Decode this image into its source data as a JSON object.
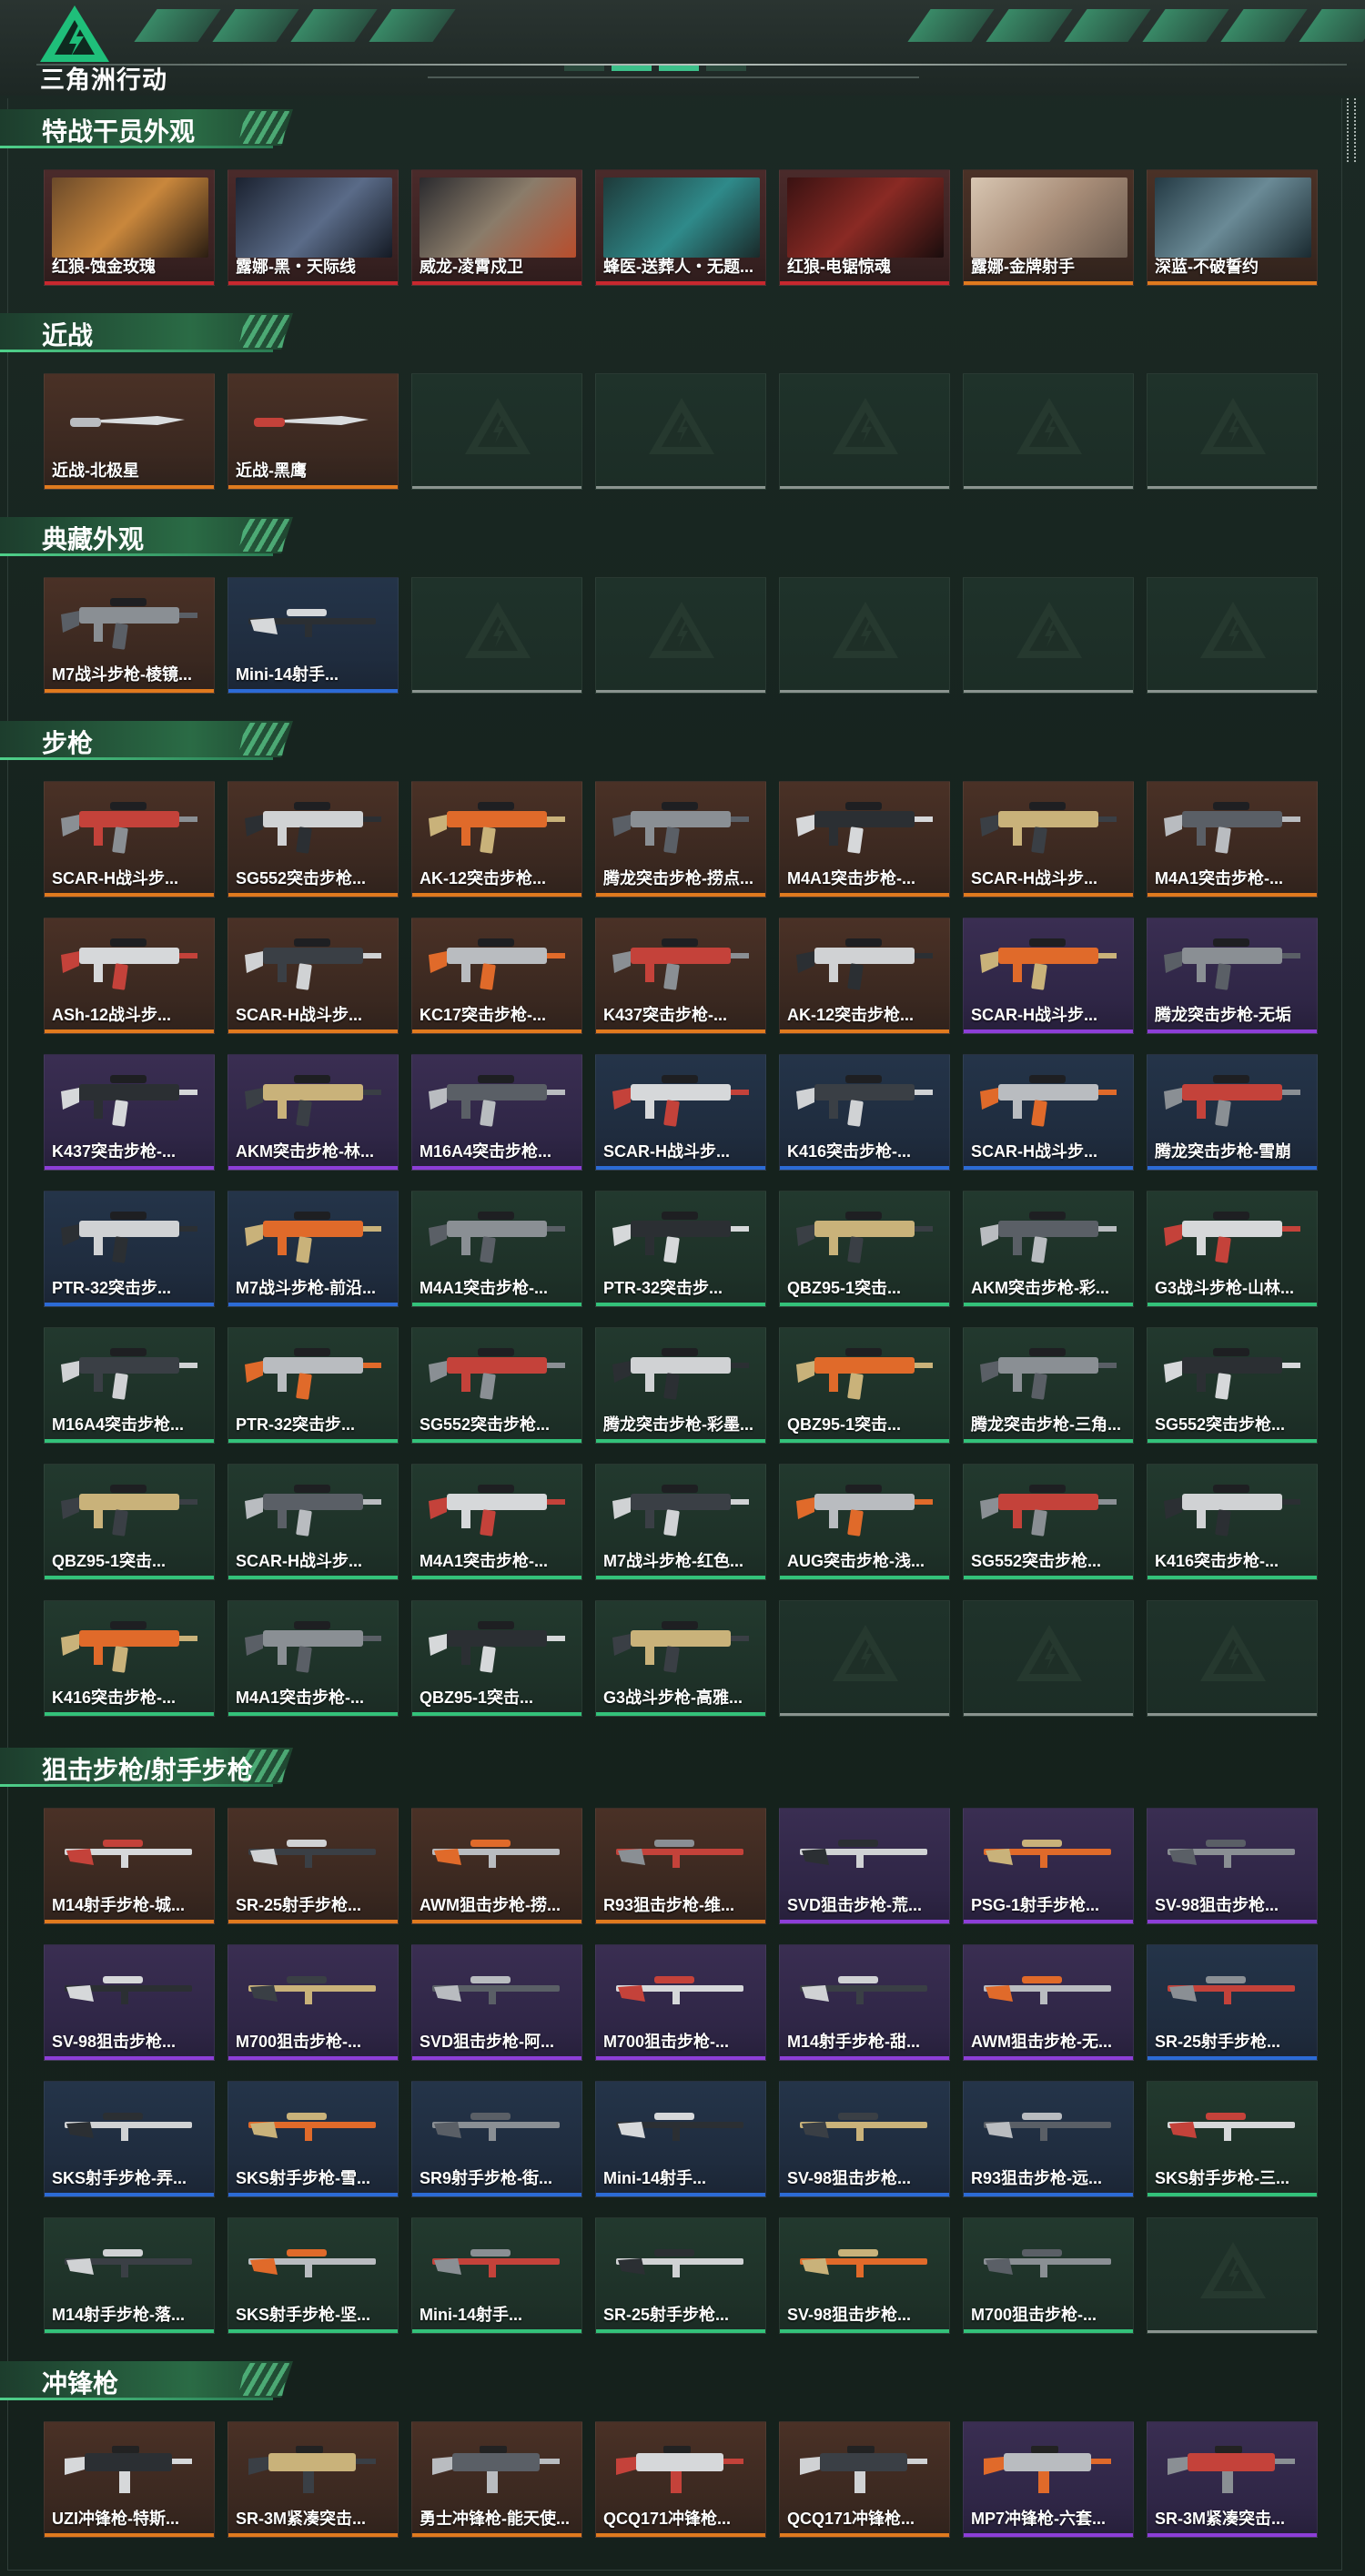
{
  "app": {
    "logo_text": "三角洲行动"
  },
  "colors": {
    "accent": "#33c27a",
    "orange": "#e07a1e",
    "red": "#c8282e",
    "purple": "#8d3ed8",
    "blue": "#2c6bd6",
    "green": "#33c27a"
  },
  "sections": [
    {
      "title": "特战干员外观",
      "items": [
        {
          "name": "红狼-蚀金玫瑰",
          "rarity": "red",
          "kind": "operator"
        },
        {
          "name": "露娜-黑・天际线",
          "rarity": "red",
          "kind": "operator"
        },
        {
          "name": "威龙-凌霄戍卫",
          "rarity": "red",
          "kind": "operator"
        },
        {
          "name": "蜂医-送葬人・无题...",
          "rarity": "red",
          "kind": "operator"
        },
        {
          "name": "红狼-电锯惊魂",
          "rarity": "red",
          "kind": "operator"
        },
        {
          "name": "露娜-金牌射手",
          "rarity": "orange",
          "kind": "operator"
        },
        {
          "name": "深蓝-不破誓约",
          "rarity": "orange",
          "kind": "operator"
        }
      ]
    },
    {
      "title": "近战",
      "items": [
        {
          "name": "近战-北极星",
          "rarity": "orange",
          "kind": "knife"
        },
        {
          "name": "近战-黑鹰",
          "rarity": "orange",
          "kind": "knife"
        },
        {
          "name": "",
          "rarity": "empty",
          "kind": "empty"
        },
        {
          "name": "",
          "rarity": "empty",
          "kind": "empty"
        },
        {
          "name": "",
          "rarity": "empty",
          "kind": "empty"
        },
        {
          "name": "",
          "rarity": "empty",
          "kind": "empty"
        },
        {
          "name": "",
          "rarity": "empty",
          "kind": "empty"
        }
      ]
    },
    {
      "title": "典藏外观",
      "items": [
        {
          "name": "M7战斗步枪-棱镜...",
          "rarity": "orange",
          "kind": "rifle"
        },
        {
          "name": "Mini-14射手...",
          "rarity": "blue",
          "kind": "sniper"
        },
        {
          "name": "",
          "rarity": "empty",
          "kind": "empty"
        },
        {
          "name": "",
          "rarity": "empty",
          "kind": "empty"
        },
        {
          "name": "",
          "rarity": "empty",
          "kind": "empty"
        },
        {
          "name": "",
          "rarity": "empty",
          "kind": "empty"
        },
        {
          "name": "",
          "rarity": "empty",
          "kind": "empty"
        }
      ]
    },
    {
      "title": "步枪",
      "items": [
        {
          "name": "SCAR-H战斗步...",
          "rarity": "orange",
          "kind": "rifle"
        },
        {
          "name": "SG552突击步枪...",
          "rarity": "orange",
          "kind": "rifle"
        },
        {
          "name": "AK-12突击步枪...",
          "rarity": "orange",
          "kind": "rifle"
        },
        {
          "name": "腾龙突击步枪-捞点...",
          "rarity": "orange",
          "kind": "rifle"
        },
        {
          "name": "M4A1突击步枪-...",
          "rarity": "orange",
          "kind": "rifle"
        },
        {
          "name": "SCAR-H战斗步...",
          "rarity": "orange",
          "kind": "rifle"
        },
        {
          "name": "M4A1突击步枪-...",
          "rarity": "orange",
          "kind": "rifle"
        },
        {
          "name": "ASh-12战斗步...",
          "rarity": "orange",
          "kind": "rifle"
        },
        {
          "name": "SCAR-H战斗步...",
          "rarity": "orange",
          "kind": "rifle"
        },
        {
          "name": "KC17突击步枪-...",
          "rarity": "orange",
          "kind": "rifle"
        },
        {
          "name": "K437突击步枪-...",
          "rarity": "orange",
          "kind": "rifle"
        },
        {
          "name": "AK-12突击步枪...",
          "rarity": "orange",
          "kind": "rifle"
        },
        {
          "name": "SCAR-H战斗步...",
          "rarity": "purple",
          "kind": "rifle"
        },
        {
          "name": "腾龙突击步枪-无垢",
          "rarity": "purple",
          "kind": "rifle"
        },
        {
          "name": "K437突击步枪-...",
          "rarity": "purple",
          "kind": "rifle"
        },
        {
          "name": "AKM突击步枪-林...",
          "rarity": "purple",
          "kind": "rifle"
        },
        {
          "name": "M16A4突击步枪...",
          "rarity": "purple",
          "kind": "rifle"
        },
        {
          "name": "SCAR-H战斗步...",
          "rarity": "blue",
          "kind": "rifle"
        },
        {
          "name": "K416突击步枪-...",
          "rarity": "blue",
          "kind": "rifle"
        },
        {
          "name": "SCAR-H战斗步...",
          "rarity": "blue",
          "kind": "rifle"
        },
        {
          "name": "腾龙突击步枪-雪崩",
          "rarity": "blue",
          "kind": "rifle"
        },
        {
          "name": "PTR-32突击步...",
          "rarity": "blue",
          "kind": "rifle"
        },
        {
          "name": "M7战斗步枪-前沿...",
          "rarity": "blue",
          "kind": "rifle"
        },
        {
          "name": "M4A1突击步枪-...",
          "rarity": "green",
          "kind": "rifle"
        },
        {
          "name": "PTR-32突击步...",
          "rarity": "green",
          "kind": "rifle"
        },
        {
          "name": "QBZ95-1突击...",
          "rarity": "green",
          "kind": "rifle"
        },
        {
          "name": "AKM突击步枪-彩...",
          "rarity": "green",
          "kind": "rifle"
        },
        {
          "name": "G3战斗步枪-山林...",
          "rarity": "green",
          "kind": "rifle"
        },
        {
          "name": "M16A4突击步枪...",
          "rarity": "green",
          "kind": "rifle"
        },
        {
          "name": "PTR-32突击步...",
          "rarity": "green",
          "kind": "rifle"
        },
        {
          "name": "SG552突击步枪...",
          "rarity": "green",
          "kind": "rifle"
        },
        {
          "name": "腾龙突击步枪-彩墨...",
          "rarity": "green",
          "kind": "rifle"
        },
        {
          "name": "QBZ95-1突击...",
          "rarity": "green",
          "kind": "rifle"
        },
        {
          "name": "腾龙突击步枪-三角...",
          "rarity": "green",
          "kind": "rifle"
        },
        {
          "name": "SG552突击步枪...",
          "rarity": "green",
          "kind": "rifle"
        },
        {
          "name": "QBZ95-1突击...",
          "rarity": "green",
          "kind": "rifle"
        },
        {
          "name": "SCAR-H战斗步...",
          "rarity": "green",
          "kind": "rifle"
        },
        {
          "name": "M4A1突击步枪-...",
          "rarity": "green",
          "kind": "rifle"
        },
        {
          "name": "M7战斗步枪-红色...",
          "rarity": "green",
          "kind": "rifle"
        },
        {
          "name": "AUG突击步枪-浅...",
          "rarity": "green",
          "kind": "rifle"
        },
        {
          "name": "SG552突击步枪...",
          "rarity": "green",
          "kind": "rifle"
        },
        {
          "name": "K416突击步枪-...",
          "rarity": "green",
          "kind": "rifle"
        },
        {
          "name": "K416突击步枪-...",
          "rarity": "green",
          "kind": "rifle"
        },
        {
          "name": "M4A1突击步枪-...",
          "rarity": "green",
          "kind": "rifle"
        },
        {
          "name": "QBZ95-1突击...",
          "rarity": "green",
          "kind": "rifle"
        },
        {
          "name": "G3战斗步枪-高雅...",
          "rarity": "green",
          "kind": "rifle"
        },
        {
          "name": "",
          "rarity": "empty",
          "kind": "empty"
        },
        {
          "name": "",
          "rarity": "empty",
          "kind": "empty"
        },
        {
          "name": "",
          "rarity": "empty",
          "kind": "empty"
        }
      ]
    },
    {
      "title": "狙击步枪/射手步枪",
      "items": [
        {
          "name": "M14射手步枪-城...",
          "rarity": "orange",
          "kind": "sniper"
        },
        {
          "name": "SR-25射手步枪...",
          "rarity": "orange",
          "kind": "sniper"
        },
        {
          "name": "AWM狙击步枪-捞...",
          "rarity": "orange",
          "kind": "sniper"
        },
        {
          "name": "R93狙击步枪-维...",
          "rarity": "orange",
          "kind": "sniper"
        },
        {
          "name": "SVD狙击步枪-荒...",
          "rarity": "purple",
          "kind": "sniper"
        },
        {
          "name": "PSG-1射手步枪...",
          "rarity": "purple",
          "kind": "sniper"
        },
        {
          "name": "SV-98狙击步枪...",
          "rarity": "purple",
          "kind": "sniper"
        },
        {
          "name": "SV-98狙击步枪...",
          "rarity": "purple",
          "kind": "sniper"
        },
        {
          "name": "M700狙击步枪-...",
          "rarity": "purple",
          "kind": "sniper"
        },
        {
          "name": "SVD狙击步枪-阿...",
          "rarity": "purple",
          "kind": "sniper"
        },
        {
          "name": "M700狙击步枪-...",
          "rarity": "purple",
          "kind": "sniper"
        },
        {
          "name": "M14射手步枪-甜...",
          "rarity": "purple",
          "kind": "sniper"
        },
        {
          "name": "AWM狙击步枪-无...",
          "rarity": "purple",
          "kind": "sniper"
        },
        {
          "name": "SR-25射手步枪...",
          "rarity": "blue",
          "kind": "sniper"
        },
        {
          "name": "SKS射手步枪-弄...",
          "rarity": "blue",
          "kind": "sniper"
        },
        {
          "name": "SKS射手步枪-雪...",
          "rarity": "blue",
          "kind": "sniper"
        },
        {
          "name": "SR9射手步枪-街...",
          "rarity": "blue",
          "kind": "sniper"
        },
        {
          "name": "Mini-14射手...",
          "rarity": "blue",
          "kind": "sniper"
        },
        {
          "name": "SV-98狙击步枪...",
          "rarity": "blue",
          "kind": "sniper"
        },
        {
          "name": "R93狙击步枪-远...",
          "rarity": "blue",
          "kind": "sniper"
        },
        {
          "name": "SKS射手步枪-三...",
          "rarity": "green",
          "kind": "sniper"
        },
        {
          "name": "M14射手步枪-落...",
          "rarity": "green",
          "kind": "sniper"
        },
        {
          "name": "SKS射手步枪-坚...",
          "rarity": "green",
          "kind": "sniper"
        },
        {
          "name": "Mini-14射手...",
          "rarity": "green",
          "kind": "sniper"
        },
        {
          "name": "SR-25射手步枪...",
          "rarity": "green",
          "kind": "sniper"
        },
        {
          "name": "SV-98狙击步枪...",
          "rarity": "green",
          "kind": "sniper"
        },
        {
          "name": "M700狙击步枪-...",
          "rarity": "green",
          "kind": "sniper"
        },
        {
          "name": "",
          "rarity": "empty",
          "kind": "empty"
        }
      ]
    },
    {
      "title": "冲锋枪",
      "items": [
        {
          "name": "UZI冲锋枪-特斯...",
          "rarity": "orange",
          "kind": "smg"
        },
        {
          "name": "SR-3M紧凑突击...",
          "rarity": "orange",
          "kind": "smg"
        },
        {
          "name": "勇士冲锋枪-能天使...",
          "rarity": "orange",
          "kind": "smg"
        },
        {
          "name": "QCQ171冲锋枪...",
          "rarity": "orange",
          "kind": "smg"
        },
        {
          "name": "QCQ171冲锋枪...",
          "rarity": "orange",
          "kind": "smg"
        },
        {
          "name": "MP7冲锋枪-六套...",
          "rarity": "purple",
          "kind": "smg"
        },
        {
          "name": "SR-3M紧凑突击...",
          "rarity": "purple",
          "kind": "smg"
        }
      ]
    }
  ]
}
